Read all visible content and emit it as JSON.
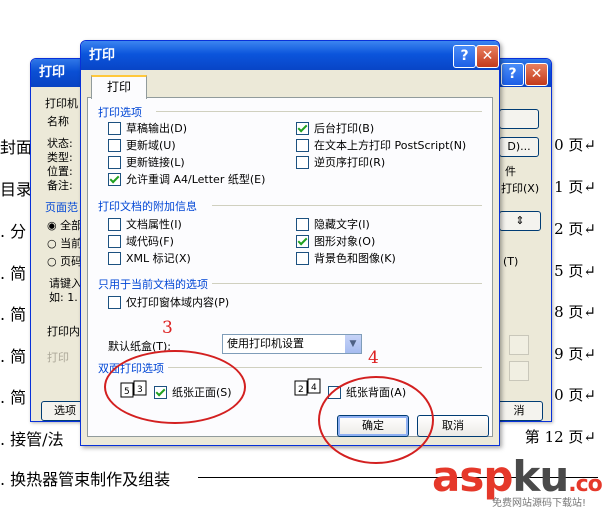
{
  "document": {
    "lines": [
      {
        "text": "封面",
        "page": "0 页↵"
      },
      {
        "text": "目录",
        "page": "1 页↵"
      },
      {
        "text": ". 分",
        "page": "2 页↵"
      },
      {
        "text": ". 简",
        "page": "5 页↵"
      },
      {
        "text": ". 简",
        "page": "8 页↵"
      },
      {
        "text": ". 简",
        "page": "9 页↵"
      },
      {
        "text": ". 简",
        "page": "10 页↵"
      },
      {
        "text": ". 接管/法",
        "page": "第 12 页↵"
      },
      {
        "text": ". 换热器管束制作及组装",
        "page": ""
      }
    ]
  },
  "back_dialog": {
    "title": "打印",
    "labels": [
      "打印机",
      "名称",
      "状态:",
      "类型:",
      "位置:",
      "备注:",
      "页面范",
      "全部",
      "当前",
      "页码",
      "请键入",
      "如: 1.",
      "打印内",
      "打印",
      "件",
      "打印(X)",
      "(T)"
    ],
    "options_button": "选项",
    "cancel_button": "消"
  },
  "front_dialog": {
    "title": "打印",
    "tab": "打印",
    "groups": {
      "print_options": "打印选项",
      "extra_info": "打印文档的附加信息",
      "current_doc": "只用于当前文档的选项",
      "duplex": "双面打印选项"
    },
    "print_options": {
      "draft": {
        "label": "草稿输出(D)",
        "checked": false
      },
      "update_fields": {
        "label": "更新域(U)",
        "checked": false
      },
      "update_links": {
        "label": "更新链接(L)",
        "checked": false
      },
      "allow_a4": {
        "label": "允许重调 A4/Letter 纸型(E)",
        "checked": true
      },
      "background": {
        "label": "后台打印(B)",
        "checked": true
      },
      "postscript": {
        "label": "在文本上方打印 PostScript(N)",
        "checked": false
      },
      "reverse": {
        "label": "逆页序打印(R)",
        "checked": false
      }
    },
    "extra_info": {
      "doc_props": {
        "label": "文档属性(I)",
        "checked": false
      },
      "field_codes": {
        "label": "域代码(F)",
        "checked": false
      },
      "xml_tags": {
        "label": "XML 标记(X)",
        "checked": false
      },
      "hidden_text": {
        "label": "隐藏文字(I)",
        "checked": false
      },
      "drawing_objects": {
        "label": "图形对象(O)",
        "checked": true
      },
      "bg_colors": {
        "label": "背景色和图像(K)",
        "checked": false
      }
    },
    "current_doc": {
      "form_data": {
        "label": "仅打印窗体域内容(P)",
        "checked": false
      }
    },
    "default_tray_label": "默认纸盒(T):",
    "default_tray_value": "使用打印机设置",
    "duplex": {
      "front": {
        "label": "纸张正面(S)",
        "checked": true
      },
      "back": {
        "label": "纸张背面(A)",
        "checked": false
      }
    },
    "ok_button": "确定",
    "cancel_button": "取消"
  },
  "annotations": {
    "num3": "3",
    "num4": "4"
  },
  "watermark": {
    "brand_a": "asp",
    "brand_b": "ku",
    "domain": ".com",
    "subtitle": "免费网站源码下载站!"
  },
  "colors": {
    "title_bar": "#0a4fd4",
    "dialog_bg": "#ece9d8",
    "accent_red": "#d32020",
    "group_text": "#0046d5"
  }
}
